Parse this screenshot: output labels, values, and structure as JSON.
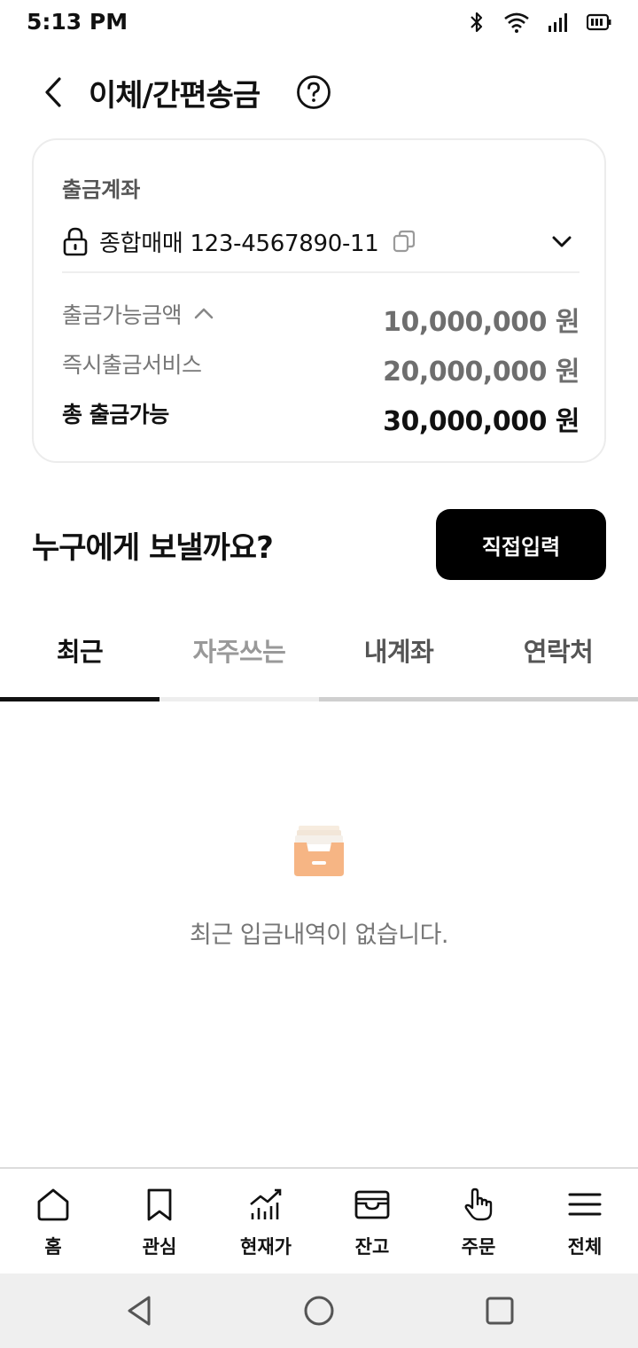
{
  "status_bar": {
    "time": "5:13 PM"
  },
  "header": {
    "title": "이체/간편송금"
  },
  "account": {
    "label": "출금계좌",
    "name": "종합매매 123-4567890-11",
    "rows": [
      {
        "label": "출금가능금액",
        "value": "10,000,000 원"
      },
      {
        "label": "즉시출금서비스",
        "value": "20,000,000 원"
      },
      {
        "label": "총 출금가능",
        "value": "30,000,000 원"
      }
    ]
  },
  "recipient": {
    "title": "누구에게 보낼까요?",
    "direct_input_label": "직접입력"
  },
  "tabs": [
    {
      "label": "최근",
      "active": true
    },
    {
      "label": "자주쓰는",
      "active": false
    },
    {
      "label": "내계좌",
      "active": false
    },
    {
      "label": "연락처",
      "active": false
    }
  ],
  "empty_state": {
    "message": "최근 입금내역이 없습니다."
  },
  "bottom_nav": [
    {
      "label": "홈",
      "icon": "home-icon"
    },
    {
      "label": "관심",
      "icon": "bookmark-icon"
    },
    {
      "label": "현재가",
      "icon": "chart-icon"
    },
    {
      "label": "잔고",
      "icon": "wallet-icon"
    },
    {
      "label": "주문",
      "icon": "hand-pointer-icon"
    },
    {
      "label": "전체",
      "icon": "menu-icon"
    }
  ],
  "colors": {
    "accent_icon": "#f6b584",
    "button_bg": "#000000"
  }
}
